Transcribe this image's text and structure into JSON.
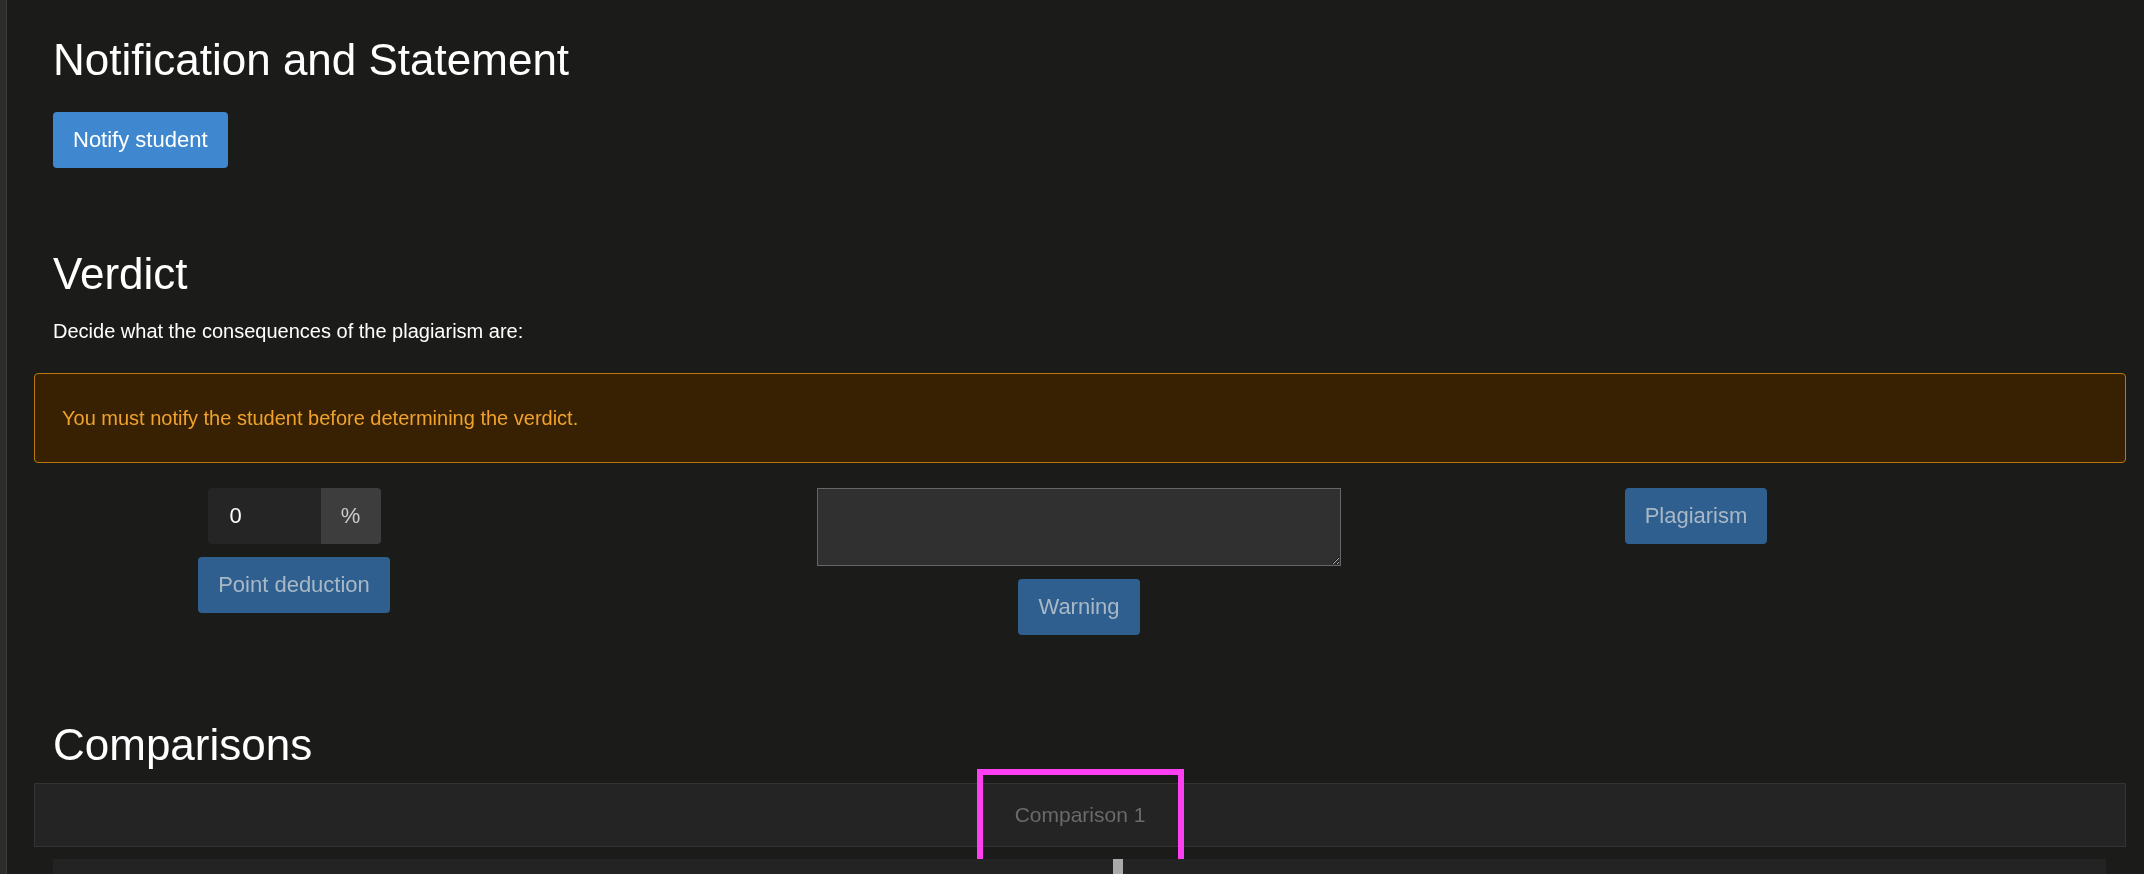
{
  "notification": {
    "title": "Notification and Statement",
    "button": {
      "label": "Notify student",
      "disabled": false
    }
  },
  "verdict": {
    "title": "Verdict",
    "description": "Decide what the consequences of the plagiarism are:",
    "alert": "You must notify the student before determining the verdict.",
    "point_deduction": {
      "value": "0",
      "unit": "%",
      "button": {
        "label": "Point deduction",
        "disabled": true
      }
    },
    "warning": {
      "button": {
        "label": "Warning",
        "disabled": true
      }
    },
    "plagiarism": {
      "button": {
        "label": "Plagiarism",
        "disabled": true
      }
    }
  },
  "comparisons": {
    "title": "Comparisons",
    "tabs": [
      {
        "label": "Comparison 1",
        "highlighted": true
      }
    ]
  }
}
